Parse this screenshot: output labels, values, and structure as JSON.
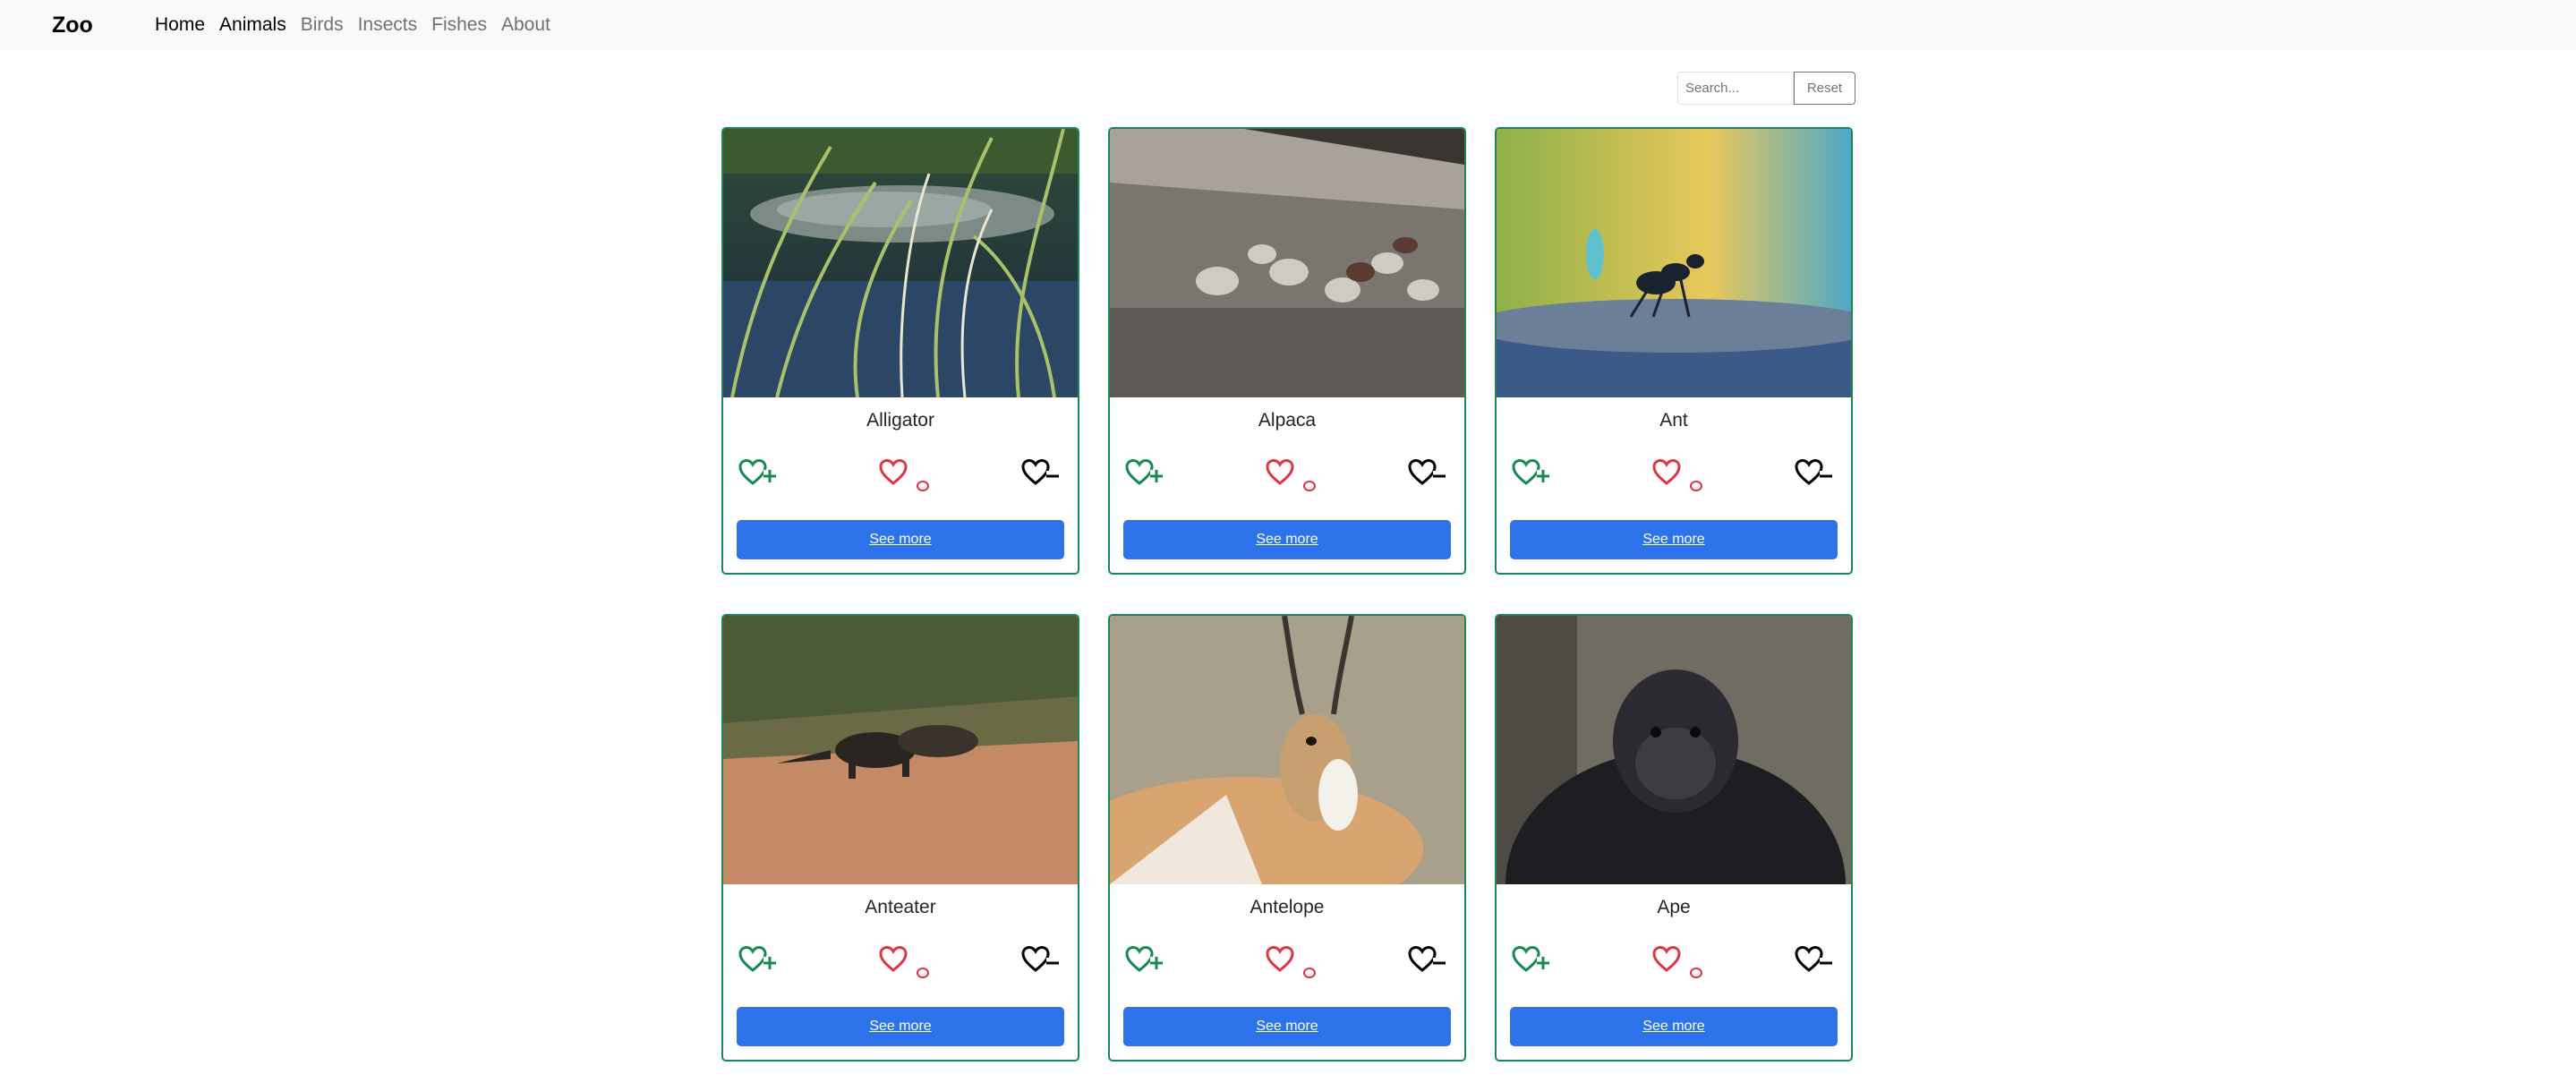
{
  "navbar": {
    "brand": "Zoo",
    "links": [
      "Home",
      "Animals",
      "Birds",
      "Insects",
      "Fishes",
      "About"
    ]
  },
  "search": {
    "placeholder": "Search...",
    "value": "",
    "reset_label": "Reset"
  },
  "colors": {
    "card_border": "#198754",
    "like_icon": "#198754",
    "favorite_icon": "#dc3545",
    "dislike_icon": "#000000",
    "button": "#2f73ea"
  },
  "cards": [
    {
      "name": "Alligator",
      "button_label": "See more",
      "image": "alligator-photo",
      "favorites": "0"
    },
    {
      "name": "Alpaca",
      "button_label": "See more",
      "image": "alpaca-photo",
      "favorites": "0"
    },
    {
      "name": "Ant",
      "button_label": "See more",
      "image": "ant-photo",
      "favorites": "0"
    },
    {
      "name": "Anteater",
      "button_label": "See more",
      "image": "anteater-photo",
      "favorites": "0"
    },
    {
      "name": "Antelope",
      "button_label": "See more",
      "image": "antelope-photo",
      "favorites": "0"
    },
    {
      "name": "Ape",
      "button_label": "See more",
      "image": "ape-photo",
      "favorites": "0"
    }
  ],
  "icons": {
    "like": "heart-plus-icon",
    "favorite": "heart-icon",
    "dislike": "heart-minus-icon"
  }
}
